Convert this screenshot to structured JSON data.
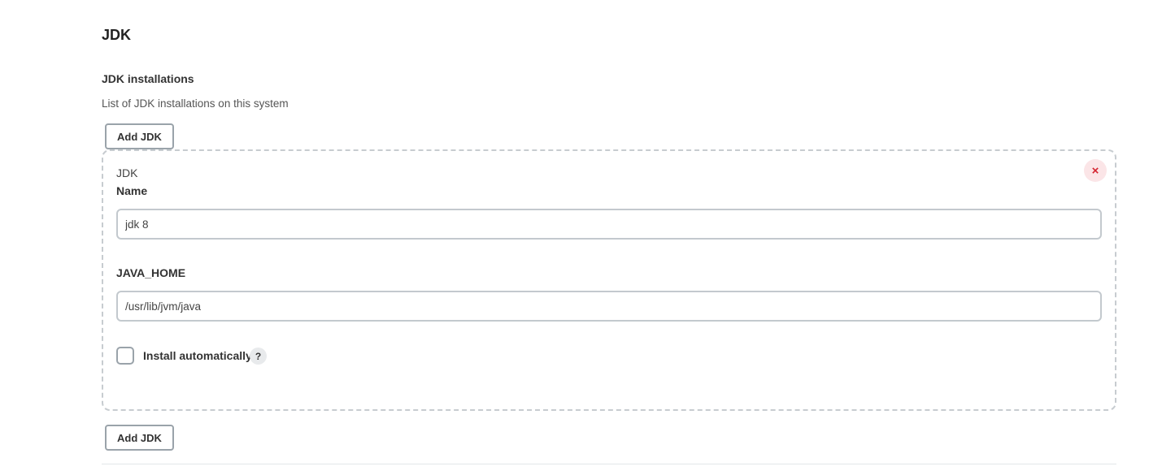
{
  "section": {
    "title": "JDK"
  },
  "jdk_installations": {
    "label": "JDK installations",
    "description": "List of JDK installations on this system",
    "add_button_label": "Add JDK",
    "items": [
      {
        "header": "JDK",
        "delete_icon": "close-icon",
        "delete_glyph": "×",
        "name_label": "Name",
        "name_value": "jdk 8",
        "java_home_label": "JAVA_HOME",
        "java_home_value": "/usr/lib/jvm/java",
        "install_auto_label": "Install automatically",
        "install_auto_checked": false,
        "help_glyph": "?"
      }
    ]
  },
  "colors": {
    "delete_bg": "#fbe5e7",
    "delete_fg": "#d4232f",
    "border": "#9aa3aa",
    "dashed_border": "#c7ccd0"
  }
}
